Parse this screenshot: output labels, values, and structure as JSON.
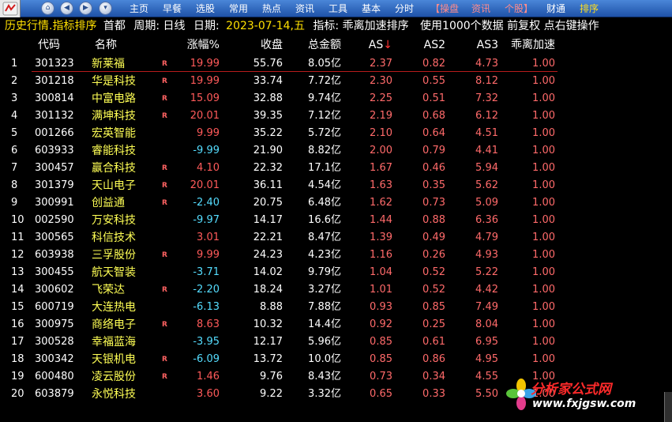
{
  "menubar": {
    "items": [
      "主页",
      "早餐",
      "选股",
      "常用",
      "热点",
      "资讯",
      "工具",
      "基本",
      "分时",
      "【操盘",
      "资讯",
      "个股】",
      "财通",
      "排序"
    ],
    "active": "排序"
  },
  "info": {
    "left": "历史行情.指标排序",
    "board": "首都",
    "period": "周期: 日线",
    "date_label": "日期:",
    "date_value": "2023-07-14,五",
    "indicator": "指标: 乖离加速排序",
    "settings": "使用1000个数据 前复权 点右键操作"
  },
  "columns": {
    "code": "代码",
    "name": "名称",
    "chg": "涨幅%",
    "close": "收盘",
    "cap": "总金额",
    "as": "AS",
    "sort_arrow": "↓",
    "as2": "AS2",
    "as3": "AS3",
    "acc": "乖离加速"
  },
  "rows": [
    {
      "idx": "1",
      "code": "301323",
      "name": "新莱福",
      "flag": "R",
      "chg": "19.99",
      "close": "55.76",
      "cap": "8.05亿",
      "as": "2.37",
      "as2": "0.82",
      "as3": "4.73",
      "acc": "1.00",
      "dir": "up"
    },
    {
      "idx": "2",
      "code": "301218",
      "name": "华是科技",
      "flag": "R",
      "chg": "19.99",
      "close": "33.74",
      "cap": "7.72亿",
      "as": "2.30",
      "as2": "0.55",
      "as3": "8.12",
      "acc": "1.00",
      "dir": "up"
    },
    {
      "idx": "3",
      "code": "300814",
      "name": "中富电路",
      "flag": "R",
      "chg": "15.09",
      "close": "32.88",
      "cap": "9.74亿",
      "as": "2.25",
      "as2": "0.51",
      "as3": "7.32",
      "acc": "1.00",
      "dir": "up"
    },
    {
      "idx": "4",
      "code": "301132",
      "name": "满坤科技",
      "flag": "R",
      "chg": "20.01",
      "close": "39.35",
      "cap": "7.12亿",
      "as": "2.19",
      "as2": "0.68",
      "as3": "6.12",
      "acc": "1.00",
      "dir": "up"
    },
    {
      "idx": "5",
      "code": "001266",
      "name": "宏英智能",
      "flag": "",
      "chg": "9.99",
      "close": "35.22",
      "cap": "5.72亿",
      "as": "2.10",
      "as2": "0.64",
      "as3": "4.51",
      "acc": "1.00",
      "dir": "up"
    },
    {
      "idx": "6",
      "code": "603933",
      "name": "睿能科技",
      "flag": "",
      "chg": "-9.99",
      "close": "21.90",
      "cap": "8.82亿",
      "as": "2.00",
      "as2": "0.79",
      "as3": "4.41",
      "acc": "1.00",
      "dir": "dn"
    },
    {
      "idx": "7",
      "code": "300457",
      "name": "赢合科技",
      "flag": "R",
      "chg": "4.10",
      "close": "22.32",
      "cap": "17.1亿",
      "as": "1.67",
      "as2": "0.46",
      "as3": "5.94",
      "acc": "1.00",
      "dir": "up"
    },
    {
      "idx": "8",
      "code": "301379",
      "name": "天山电子",
      "flag": "R",
      "chg": "20.01",
      "close": "36.11",
      "cap": "4.54亿",
      "as": "1.63",
      "as2": "0.35",
      "as3": "5.62",
      "acc": "1.00",
      "dir": "up"
    },
    {
      "idx": "9",
      "code": "300991",
      "name": "创益通",
      "flag": "R",
      "chg": "-2.40",
      "close": "20.75",
      "cap": "6.48亿",
      "as": "1.62",
      "as2": "0.73",
      "as3": "5.09",
      "acc": "1.00",
      "dir": "dn"
    },
    {
      "idx": "10",
      "code": "002590",
      "name": "万安科技",
      "flag": "",
      "chg": "-9.97",
      "close": "14.17",
      "cap": "16.6亿",
      "as": "1.44",
      "as2": "0.88",
      "as3": "6.36",
      "acc": "1.00",
      "dir": "dn"
    },
    {
      "idx": "11",
      "code": "300565",
      "name": "科信技术",
      "flag": "",
      "chg": "3.01",
      "close": "22.21",
      "cap": "8.47亿",
      "as": "1.39",
      "as2": "0.49",
      "as3": "4.79",
      "acc": "1.00",
      "dir": "up"
    },
    {
      "idx": "12",
      "code": "603938",
      "name": "三孚股份",
      "flag": "R",
      "chg": "9.99",
      "close": "24.23",
      "cap": "4.23亿",
      "as": "1.16",
      "as2": "0.26",
      "as3": "4.93",
      "acc": "1.00",
      "dir": "up"
    },
    {
      "idx": "13",
      "code": "300455",
      "name": "航天智装",
      "flag": "",
      "chg": "-3.71",
      "close": "14.02",
      "cap": "9.79亿",
      "as": "1.04",
      "as2": "0.52",
      "as3": "5.22",
      "acc": "1.00",
      "dir": "dn"
    },
    {
      "idx": "14",
      "code": "300602",
      "name": "飞荣达",
      "flag": "R",
      "chg": "-2.20",
      "close": "18.24",
      "cap": "3.27亿",
      "as": "1.01",
      "as2": "0.52",
      "as3": "4.42",
      "acc": "1.00",
      "dir": "dn"
    },
    {
      "idx": "15",
      "code": "600719",
      "name": "大连热电",
      "flag": "",
      "chg": "-6.13",
      "close": "8.88",
      "cap": "7.88亿",
      "as": "0.93",
      "as2": "0.85",
      "as3": "7.49",
      "acc": "1.00",
      "dir": "dn"
    },
    {
      "idx": "16",
      "code": "300975",
      "name": "商络电子",
      "flag": "R",
      "chg": "8.63",
      "close": "10.32",
      "cap": "14.4亿",
      "as": "0.92",
      "as2": "0.25",
      "as3": "8.04",
      "acc": "1.00",
      "dir": "up"
    },
    {
      "idx": "17",
      "code": "300528",
      "name": "幸福蓝海",
      "flag": "",
      "chg": "-3.95",
      "close": "12.17",
      "cap": "5.96亿",
      "as": "0.85",
      "as2": "0.61",
      "as3": "6.95",
      "acc": "1.00",
      "dir": "dn"
    },
    {
      "idx": "18",
      "code": "300342",
      "name": "天银机电",
      "flag": "R",
      "chg": "-6.09",
      "close": "13.72",
      "cap": "10.0亿",
      "as": "0.85",
      "as2": "0.86",
      "as3": "4.95",
      "acc": "1.00",
      "dir": "dn"
    },
    {
      "idx": "19",
      "code": "600480",
      "name": "凌云股份",
      "flag": "R",
      "chg": "1.46",
      "close": "9.76",
      "cap": "8.43亿",
      "as": "0.73",
      "as2": "0.34",
      "as3": "4.55",
      "acc": "1.00",
      "dir": "up"
    },
    {
      "idx": "20",
      "code": "603879",
      "name": "永悦科技",
      "flag": "",
      "chg": "3.60",
      "close": "9.22",
      "cap": "3.32亿",
      "as": "0.65",
      "as2": "0.33",
      "as3": "5.50",
      "acc": "1.00",
      "dir": "up"
    }
  ],
  "watermark": {
    "title": "分析家公式网",
    "url": "www.fxjgsw.com"
  },
  "colors": {
    "up": "#ff5a5a",
    "down": "#55ddff",
    "name": "#ffff55",
    "menubar": "#2d63bd",
    "accent": "#ffe000"
  }
}
